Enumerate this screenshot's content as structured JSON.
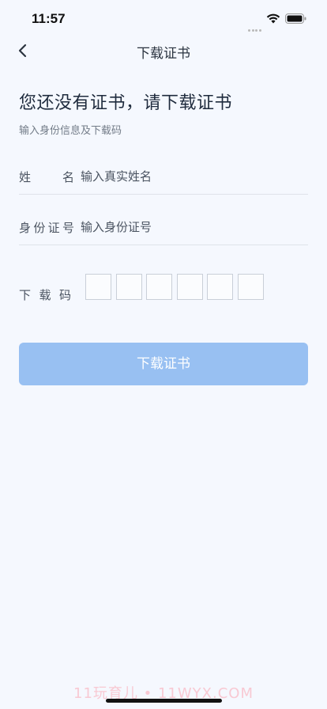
{
  "status_bar": {
    "time": "11:57"
  },
  "nav": {
    "title": "下载证书"
  },
  "header": {
    "headline": "您还没有证书，请下载证书",
    "subline": "输入身份信息及下载码"
  },
  "form": {
    "name": {
      "label": "姓名",
      "placeholder": "输入真实姓名"
    },
    "id_number": {
      "label": "身份证号",
      "placeholder": "输入身份证号"
    },
    "download_code": {
      "label": "下载码",
      "box_count": 6
    }
  },
  "actions": {
    "download_label": "下载证书"
  },
  "watermark": "11玩育儿 • 11WYX.COM"
}
